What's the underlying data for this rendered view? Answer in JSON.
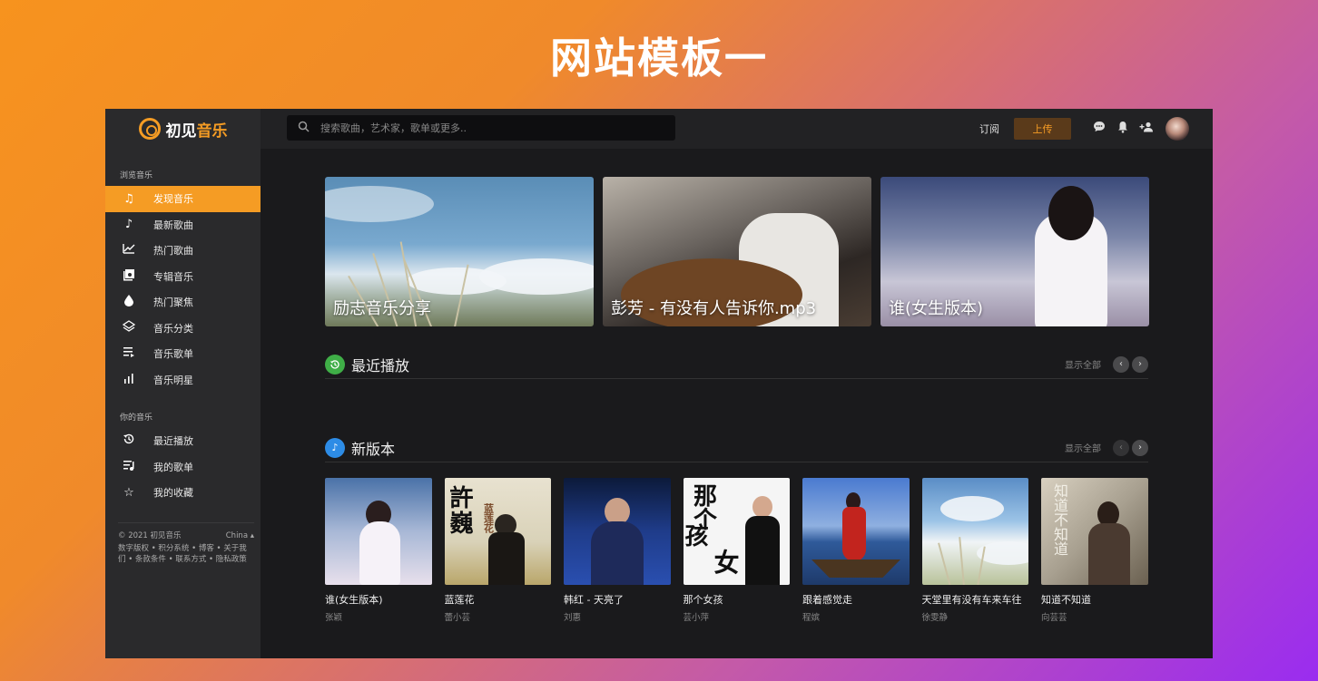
{
  "page_heading": "网站模板一",
  "logo": {
    "text_a": "初见",
    "text_b": "音乐"
  },
  "sidebar": {
    "section1_label": "浏览音乐",
    "items": [
      {
        "label": "发现音乐",
        "icon": "music-note-icon",
        "active": true
      },
      {
        "label": "最新歌曲",
        "icon": "single-note-icon"
      },
      {
        "label": "热门歌曲",
        "icon": "trending-chart-icon"
      },
      {
        "label": "专辑音乐",
        "icon": "album-icon"
      },
      {
        "label": "热门聚焦",
        "icon": "drop-icon"
      },
      {
        "label": "音乐分类",
        "icon": "layers-icon"
      },
      {
        "label": "音乐歌单",
        "icon": "playlist-icon"
      },
      {
        "label": "音乐明星",
        "icon": "bar-chart-icon"
      }
    ],
    "section2_label": "你的音乐",
    "items2": [
      {
        "label": "最近播放",
        "icon": "history-icon"
      },
      {
        "label": "我的歌单",
        "icon": "my-playlist-icon"
      },
      {
        "label": "我的收藏",
        "icon": "star-icon"
      }
    ],
    "footer": {
      "copyright": "© 2021 初见音乐",
      "region": "China ▴",
      "links": "数字版权 • 积分系统 • 博客 • 关于我们 • 条款条件 • 联系方式 • 隐私政策"
    }
  },
  "topbar": {
    "search_placeholder": "搜索歌曲，艺术家，歌单或更多..",
    "subscribe": "订阅",
    "upload": "上传"
  },
  "banners": [
    {
      "caption": "励志音乐分享"
    },
    {
      "caption": "彭芳 - 有没有人告诉你.mp3"
    },
    {
      "caption": "谁(女生版本)"
    }
  ],
  "sections": {
    "recent": {
      "title": "最近播放",
      "show_all": "显示全部"
    },
    "new": {
      "title": "新版本",
      "show_all": "显示全部"
    }
  },
  "albums": [
    {
      "title": "谁(女生版本)",
      "artist": "张颖"
    },
    {
      "title": "蓝莲花",
      "artist": "蕾小芸"
    },
    {
      "title": "韩红 - 天亮了",
      "artist": "刘惠"
    },
    {
      "title": "那个女孩",
      "artist": "芸小萍"
    },
    {
      "title": "跟着感觉走",
      "artist": "程嫔"
    },
    {
      "title": "天堂里有没有车来车往",
      "artist": "徐雯静"
    },
    {
      "title": "知道不知道",
      "artist": "向芸芸"
    }
  ],
  "cover_text": {
    "c2_a": "許",
    "c2_b": "巍",
    "c2_c": "蓝莲花",
    "c4_a": "那个",
    "c4_b": "孩",
    "c4_c": "女",
    "c7": "知道不知道"
  },
  "colors": {
    "accent": "#f59c24",
    "sidebar_bg": "#2a2a2c",
    "main_bg": "#1a1a1c"
  }
}
